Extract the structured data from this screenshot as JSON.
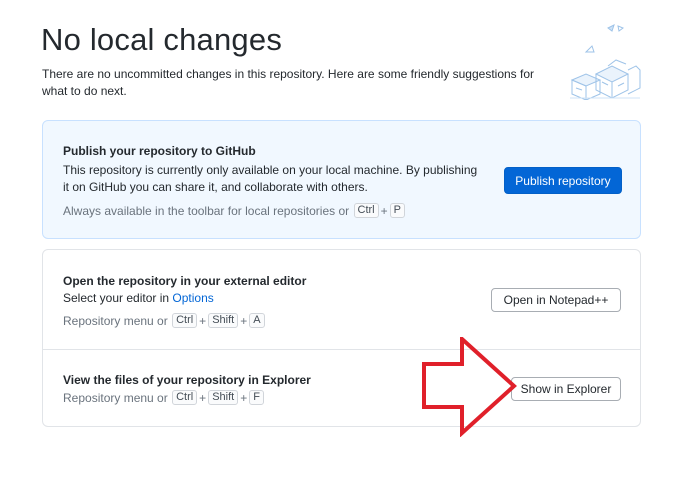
{
  "page": {
    "title": "No local changes",
    "subtitle": "There are no uncommitted changes in this repository. Here are some friendly suggestions for what to do next."
  },
  "publish": {
    "heading": "Publish your repository to GitHub",
    "description": "This repository is currently only available on your local machine. By publishing it on GitHub you can share it, and collaborate with others.",
    "hint_prefix": "Always available in the toolbar for local repositories or",
    "shortcut": [
      "Ctrl",
      "P"
    ],
    "button_label": "Publish repository"
  },
  "editor": {
    "heading": "Open the repository in your external editor",
    "description_prefix": "Select your editor in",
    "options_link": "Options",
    "hint_prefix": "Repository menu or",
    "shortcut": [
      "Ctrl",
      "Shift",
      "A"
    ],
    "button_label": "Open in Notepad++"
  },
  "explorer": {
    "heading": "View the files of your repository in Explorer",
    "hint_prefix": "Repository menu or",
    "shortcut": [
      "Ctrl",
      "Shift",
      "F"
    ],
    "button_label": "Show in Explorer"
  },
  "colors": {
    "accent": "#0366d6",
    "publish_bg": "#f1f8ff",
    "annotation_arrow": "#e0202a"
  }
}
